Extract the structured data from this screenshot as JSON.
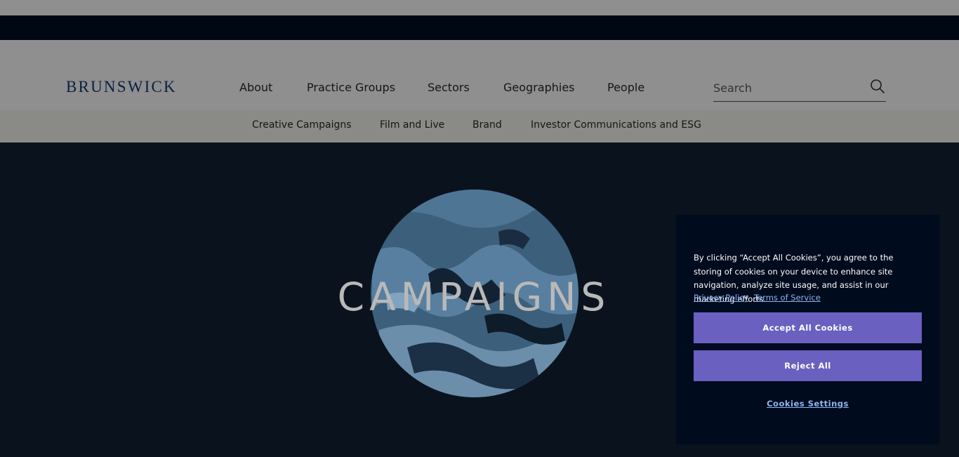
{
  "brand": {
    "logo_text": "BRUNSWICK"
  },
  "nav": {
    "items": [
      {
        "label": "About"
      },
      {
        "label": "Practice Groups"
      },
      {
        "label": "Sectors"
      },
      {
        "label": "Geographies"
      },
      {
        "label": "People"
      }
    ]
  },
  "search": {
    "placeholder": "Search",
    "value": ""
  },
  "subnav": {
    "items": [
      {
        "label": "Creative Campaigns"
      },
      {
        "label": "Film and Live"
      },
      {
        "label": "Brand"
      },
      {
        "label": "Investor Communications and ESG"
      }
    ]
  },
  "hero": {
    "title": "CAMPAIGNS"
  },
  "cookie_banner": {
    "text": "By clicking “Accept All Cookies”, you agree to the storing of cookies on your device to enhance site navigation, analyze site usage, and assist in our marketing efforts.",
    "privacy_label": "Privacy Policy",
    "terms_label": "Terms of Service",
    "accept_label": "Accept All Cookies",
    "reject_label": "Reject All",
    "settings_label": "Cookies Settings"
  },
  "colors": {
    "header_overlay": "#8f8f8f",
    "dark_navy": "#000b1e",
    "button_purple": "#6a60bf",
    "link_blue": "#8fb5f0"
  }
}
